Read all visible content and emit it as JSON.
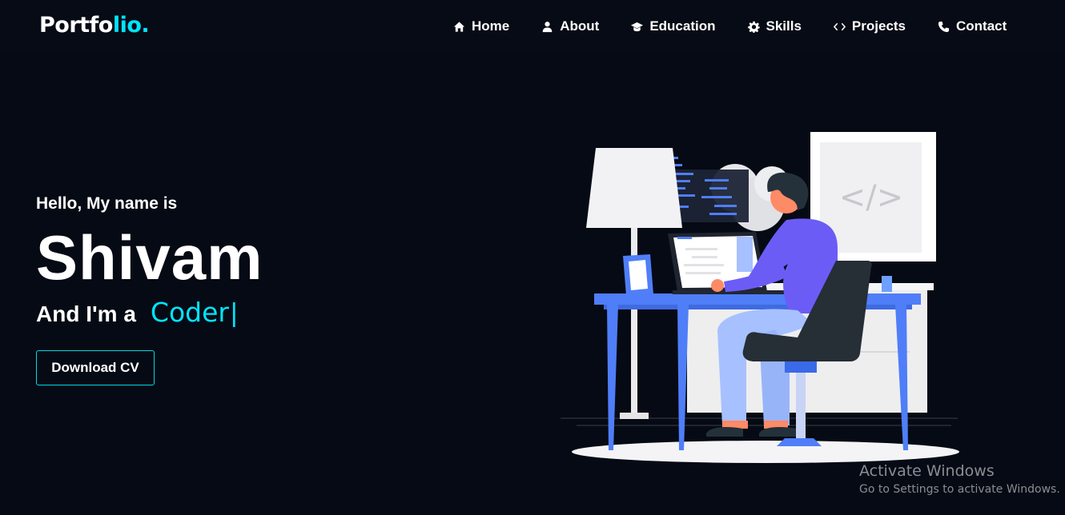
{
  "logo": {
    "main": "Portfo",
    "accent": "lio."
  },
  "nav": [
    {
      "label": "Home",
      "icon": "home-icon"
    },
    {
      "label": "About",
      "icon": "user-icon"
    },
    {
      "label": "Education",
      "icon": "graduation-cap-icon"
    },
    {
      "label": "Skills",
      "icon": "gear-icon"
    },
    {
      "label": "Projects",
      "icon": "code-icon"
    },
    {
      "label": "Contact",
      "icon": "phone-icon"
    }
  ],
  "hero": {
    "greeting": "Hello, My name is",
    "name": "Shivam",
    "role_prefix": "And I'm a",
    "role": "Coder",
    "caret": "|",
    "cv_button": "Download CV"
  },
  "watermark": {
    "title": "Activate Windows",
    "subtitle": "Go to Settings to activate Windows."
  },
  "colors": {
    "background": "#060a14",
    "accent": "#00e5ff"
  }
}
